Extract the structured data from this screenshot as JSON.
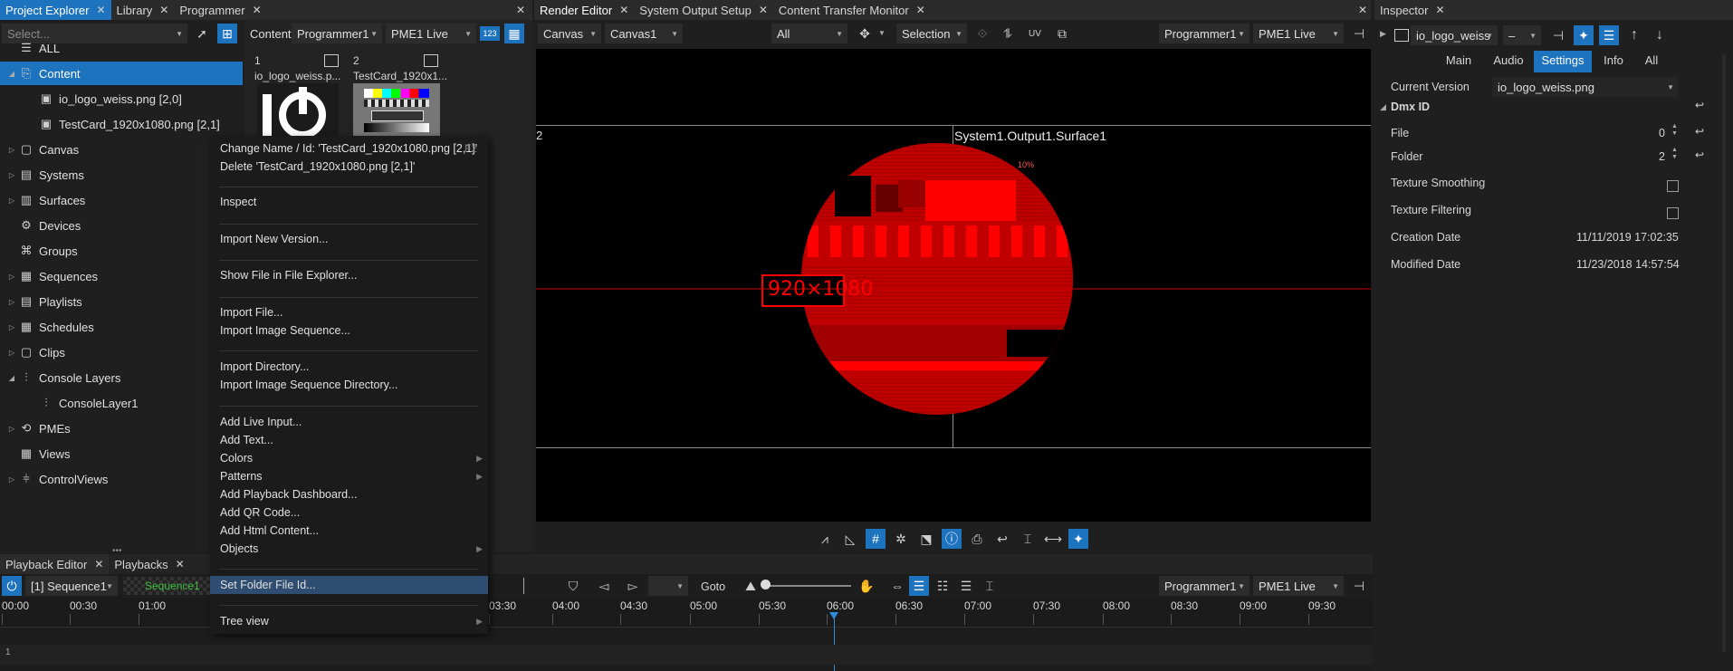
{
  "project_explorer": {
    "tabs": [
      {
        "label": "Project Explorer",
        "active": true
      },
      {
        "label": "Library",
        "active": false
      },
      {
        "label": "Programmer",
        "active": false
      }
    ],
    "select_placeholder": "Select...",
    "tree": [
      {
        "label": "ALL",
        "icon": "list-icon"
      },
      {
        "label": "Content",
        "icon": "content-icon",
        "selected": true,
        "expanded": true
      },
      {
        "label": "io_logo_weiss.png [2,0]",
        "icon": "image-icon",
        "child": true
      },
      {
        "label": "TestCard_1920x1080.png [2,1]",
        "icon": "image-icon",
        "child": true
      },
      {
        "label": "Canvas",
        "icon": "canvas-icon"
      },
      {
        "label": "Systems",
        "icon": "systems-icon"
      },
      {
        "label": "Surfaces",
        "icon": "surfaces-icon"
      },
      {
        "label": "Devices",
        "icon": "devices-icon"
      },
      {
        "label": "Groups",
        "icon": "groups-icon"
      },
      {
        "label": "Sequences",
        "icon": "sequences-icon"
      },
      {
        "label": "Playlists",
        "icon": "playlists-icon"
      },
      {
        "label": "Schedules",
        "icon": "schedules-icon"
      },
      {
        "label": "Clips",
        "icon": "clips-icon"
      },
      {
        "label": "Console Layers",
        "icon": "console-layers-icon",
        "expanded": true
      },
      {
        "label": "ConsoleLayer1",
        "icon": "console-layer-icon",
        "child": true
      },
      {
        "label": "PMEs",
        "icon": "pmes-icon"
      },
      {
        "label": "Views",
        "icon": "views-icon"
      },
      {
        "label": "ControlViews",
        "icon": "controlviews-icon"
      }
    ]
  },
  "content_panel": {
    "label": "Content",
    "programmer": "Programmer1",
    "pme": "PME1 Live",
    "badge": "123",
    "items": [
      {
        "index": "1",
        "name": "io_logo_weiss.p..."
      },
      {
        "index": "2",
        "name": "TestCard_1920x1..."
      }
    ]
  },
  "context_menu": {
    "shortcut": "F2",
    "items": [
      "Change Name / Id: 'TestCard_1920x1080.png [2,1]'",
      "Delete 'TestCard_1920x1080.png [2,1]'",
      "Inspect",
      "Import New Version...",
      "Show File in File Explorer...",
      "Import File...",
      "Import Image Sequence...",
      "Import Directory...",
      "Import Image Sequence Directory...",
      "Add Live Input...",
      "Add Text...",
      "Colors",
      "Patterns",
      "Add Playback Dashboard...",
      "Add QR Code...",
      "Add Html Content...",
      "Objects",
      "Set Folder File Id...",
      "Tree view"
    ]
  },
  "render_editor": {
    "tabs": [
      {
        "label": "Render Editor",
        "active": true
      },
      {
        "label": "System Output Setup",
        "active": false
      },
      {
        "label": "Content Transfer Monitor",
        "active": false
      }
    ],
    "canvas_type": "Canvas",
    "canvas_name": "Canvas1",
    "filter": "All",
    "mode": "Selection",
    "programmer": "Programmer1",
    "pme": "PME1 Live",
    "surface_label": "System1.Output1.Surface1",
    "left_label_fragment": "2",
    "testcard_text": "920×1080",
    "testcard_small": "10%"
  },
  "inspector": {
    "tab_label": "Inspector",
    "object_name": "io_logo_weiss",
    "dash": "–",
    "tabs": [
      {
        "label": "Main",
        "active": false
      },
      {
        "label": "Audio",
        "active": false
      },
      {
        "label": "Settings",
        "active": true
      },
      {
        "label": "Info",
        "active": false
      },
      {
        "label": "All",
        "active": false
      }
    ],
    "current_version_label": "Current Version",
    "current_version_value": "io_logo_weiss.png",
    "section": "Dmx ID",
    "file_label": "File",
    "file_value": "0",
    "folder_label": "Folder",
    "folder_value": "2",
    "texture_smoothing": "Texture Smoothing",
    "texture_filtering": "Texture Filtering",
    "creation_date_label": "Creation Date",
    "creation_date_value": "11/11/2019 17:02:35",
    "modified_date_label": "Modified Date",
    "modified_date_value": "11/23/2018 14:57:54"
  },
  "playback": {
    "tabs": [
      {
        "label": "Playback Editor",
        "active": true
      },
      {
        "label": "Playbacks",
        "active": false
      }
    ],
    "sequence": "[1] Sequence1",
    "sequence_clip": "Sequence1",
    "goto": "Goto",
    "programmer": "Programmer1",
    "pme": "PME1 Live",
    "track_number": "1",
    "timeline_labels": [
      "00:00",
      "00:30",
      "01:00",
      "03:30",
      "04:00",
      "04:30",
      "05:00",
      "05:30",
      "06:00",
      "06:30",
      "07:00",
      "07:30",
      "08:00",
      "08:30",
      "09:00",
      "09:30"
    ]
  }
}
